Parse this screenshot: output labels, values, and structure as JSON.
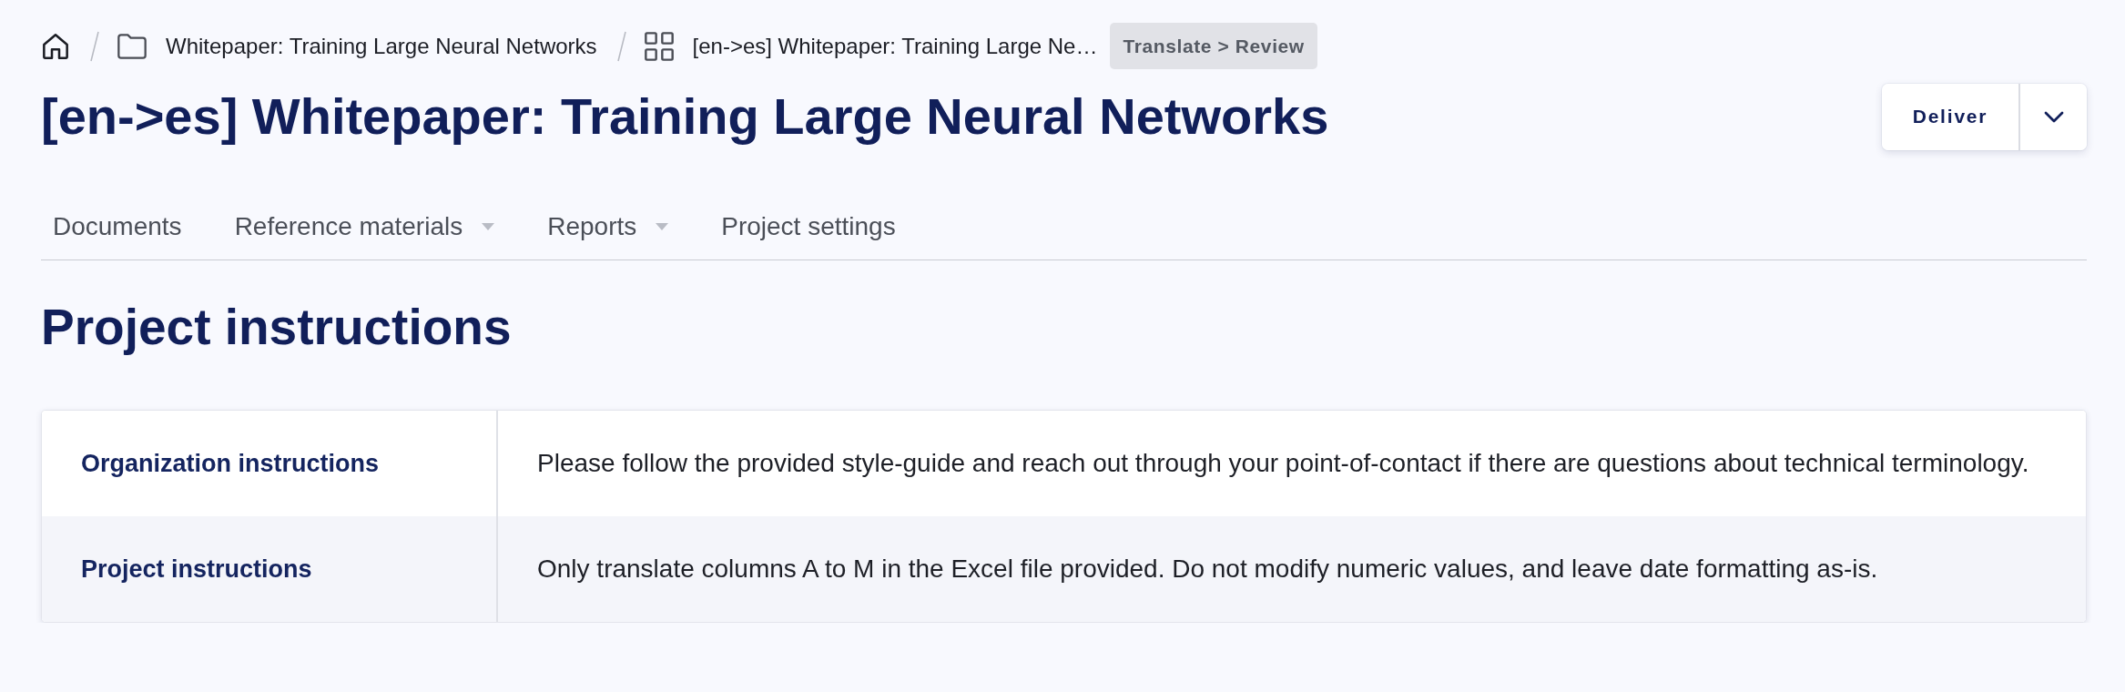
{
  "breadcrumb": [
    {
      "kind": "home"
    },
    {
      "kind": "folder",
      "label": "Whitepaper: Training Large Neural Networks"
    },
    {
      "kind": "project",
      "label": "[en->es] Whitepaper: Training Large Ne…"
    }
  ],
  "stage_badge": "Translate > Review",
  "title": "[en->es] Whitepaper: Training Large Neural Networks",
  "primary_button": "Deliver",
  "tabs": [
    {
      "label": "Documents",
      "kind": "link",
      "selected": false
    },
    {
      "label": "Reference materials",
      "kind": "menu",
      "selected": false
    },
    {
      "label": "Reports",
      "kind": "menu",
      "selected": false
    },
    {
      "label": "Project settings",
      "kind": "link",
      "selected": false
    }
  ],
  "section_title": "Project instructions",
  "instructions": [
    {
      "label": "Organization instructions",
      "text": "Please follow the provided style-guide and reach out through your point-of-contact if there are questions about technical terminology."
    },
    {
      "label": "Project instructions",
      "text": "Only translate columns A to M in the Excel file provided. Do not modify numeric values, and leave date formatting as-is."
    }
  ]
}
